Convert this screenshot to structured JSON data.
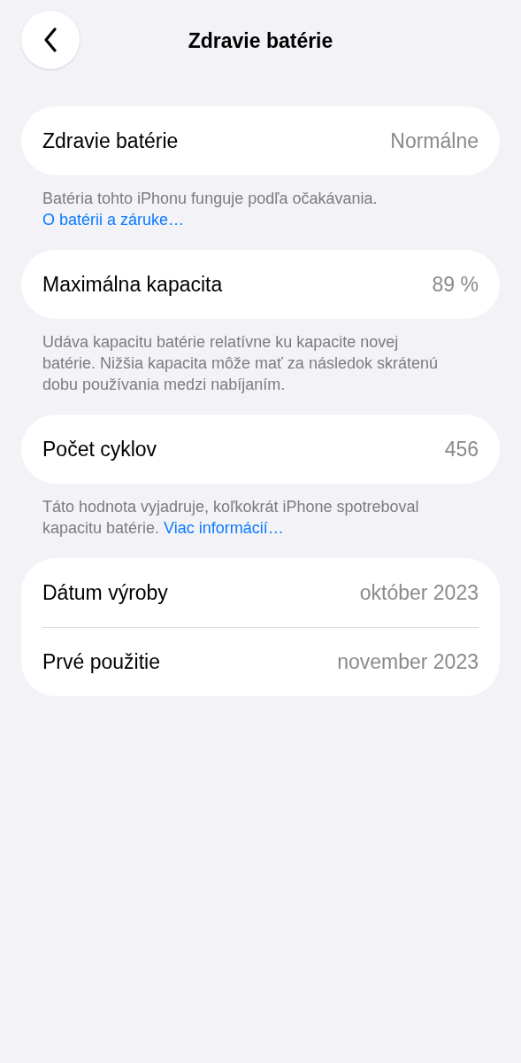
{
  "nav": {
    "title": "Zdravie batérie"
  },
  "sections": [
    {
      "rows": [
        {
          "label": "Zdravie batérie",
          "value": "Normálne"
        }
      ],
      "footer": {
        "text": "Batéria tohto iPhonu funguje podľa očakávania.",
        "link": "O batérii a záruke…"
      }
    },
    {
      "rows": [
        {
          "label": "Maximálna kapacita",
          "value": "89 %"
        }
      ],
      "footer": {
        "text": "Udáva kapacitu batérie relatívne ku kapacite novej batérie. Nižšia kapacita môže mať za následok skrátenú dobu používania medzi nabíjaním."
      }
    },
    {
      "rows": [
        {
          "label": "Počet cyklov",
          "value": "456"
        }
      ],
      "footer": {
        "text": "Táto hodnota vyjadruje, koľkokrát iPhone spotreboval kapacitu batérie.",
        "link": "Viac informácií…"
      }
    },
    {
      "rows": [
        {
          "label": "Dátum výroby",
          "value": "október 2023"
        },
        {
          "label": "Prvé použitie",
          "value": "november 2023"
        }
      ]
    }
  ]
}
